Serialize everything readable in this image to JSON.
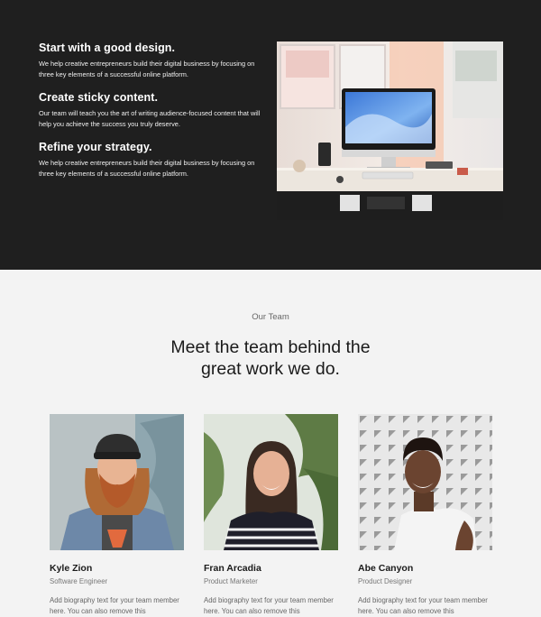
{
  "features": [
    {
      "title": "Start with a good design.",
      "text": "We help creative entrepreneurs build their digital business by focusing on three key elements of a successful online platform."
    },
    {
      "title": "Create sticky content.",
      "text": "Our team will teach you the art of writing audience-focused content that will help you achieve the success you truly deserve."
    },
    {
      "title": "Refine your strategy.",
      "text": "We help creative entrepreneurs build their digital business by focusing on three key elements of a successful online platform."
    }
  ],
  "team": {
    "eyebrow": "Our Team",
    "headline_line1": "Meet the team behind the",
    "headline_line2": "great work we do.",
    "members": [
      {
        "name": "Kyle Zion",
        "role": "Software Engineer",
        "bio": "Add biography text for your team member here. You can also remove this"
      },
      {
        "name": "Fran Arcadia",
        "role": "Product Marketer",
        "bio": "Add biography text for your team member here. You can also remove this"
      },
      {
        "name": "Abe Canyon",
        "role": "Product Designer",
        "bio": "Add biography text for your team member here. You can also remove this"
      }
    ]
  },
  "colors": {
    "dark_bg": "#1f1f1f",
    "light_bg": "#f3f3f3"
  }
}
